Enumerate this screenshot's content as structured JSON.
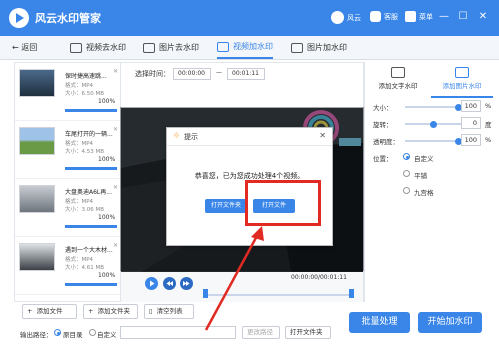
{
  "app": {
    "title": "风云水印管家",
    "links": [
      {
        "label": "风云"
      },
      {
        "label": "客服"
      },
      {
        "label": "菜单"
      }
    ],
    "window_controls": [
      "—",
      "☐",
      "✕"
    ]
  },
  "nav": {
    "back": "返回",
    "tabs": [
      {
        "label": "视频去水印"
      },
      {
        "label": "图片去水印"
      },
      {
        "label": "视频加水印",
        "active": true
      },
      {
        "label": "图片加水印"
      }
    ]
  },
  "files": [
    {
      "name": "保时捷高速跳...",
      "format": "格式：MP4",
      "size": "大小：6.50 MB",
      "progress": "100%",
      "progress_value": 1.0
    },
    {
      "name": "车尾打开的一辆...",
      "format": "格式：MP4",
      "size": "大小：4.53 MB",
      "progress": "100%",
      "progress_value": 1.0
    },
    {
      "name": "大盘奥迪A6L再...",
      "format": "格式：MP4",
      "size": "大小：3.06 MB",
      "progress": "100%",
      "progress_value": 1.0
    },
    {
      "name": "遇到一个大木材...",
      "format": "格式：MP4",
      "size": "大小：4.61 MB",
      "progress": "100%",
      "progress_value": 1.0
    }
  ],
  "preview": {
    "time_label": "选择时间：",
    "start": "00:00:00",
    "dash": "—",
    "end": "00:01:11",
    "playback": "00:00:00/00:01:11"
  },
  "right_panel": {
    "tabs": [
      {
        "label": "添加文字水印"
      },
      {
        "label": "添加图片水印",
        "active": true
      }
    ],
    "size_label": "大小：",
    "size_value": "100",
    "rotate_label": "旋转：",
    "rotate_value": "0",
    "opacity_label": "透明度：",
    "opacity_value": "100",
    "percent": "%",
    "degree": "度",
    "position_label": "位置：",
    "positions": [
      {
        "label": "自定义",
        "selected": true
      },
      {
        "label": "平铺",
        "selected": false
      },
      {
        "label": "九宫格",
        "selected": false
      }
    ]
  },
  "bottom": {
    "add_file": "添加文件",
    "add_folder": "添加文件夹",
    "clear_list": "清空列表",
    "output_label": "输出路径：",
    "opt_source": "原目录",
    "opt_custom": "自定义",
    "change_path": "更改路径",
    "open_folder": "打开文件夹",
    "batch": "批量处理",
    "start": "开始加水印"
  },
  "dialog": {
    "title": "提示",
    "close": "✕",
    "message": "恭喜您，已为您成功处理4个视频。",
    "open_folder": "打开文件夹",
    "open_file": "打开文件"
  },
  "colors": {
    "primary": "#3a86e8",
    "highlight_box": "#e12a22"
  }
}
